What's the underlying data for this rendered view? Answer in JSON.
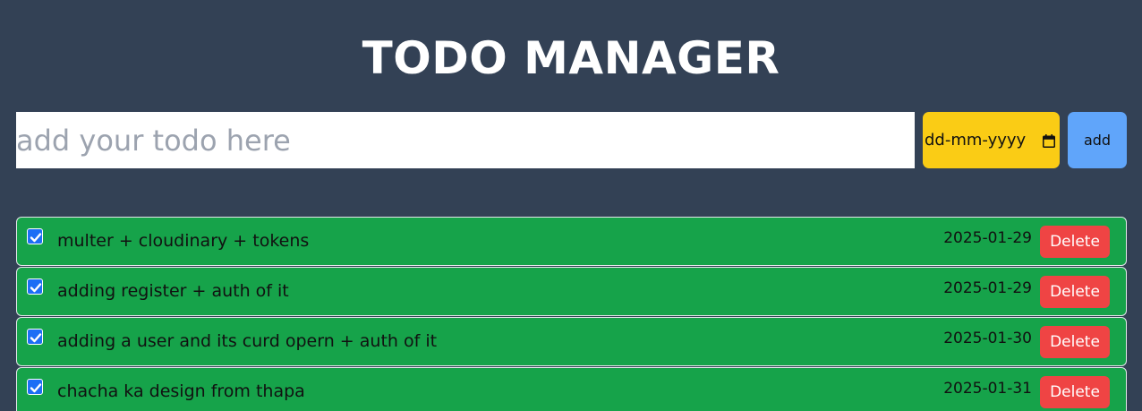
{
  "header": {
    "title": "TODO MANAGER"
  },
  "form": {
    "placeholder": "add your todo here",
    "date_value": "dd-mm-yyyy",
    "add_label": "add"
  },
  "colors": {
    "background": "#334155",
    "item_bg": "#16a34a",
    "delete_bg": "#ef4444",
    "date_bg": "#facc15",
    "add_bg": "#60a5fa"
  },
  "todos": [
    {
      "text": "multer + cloudinary + tokens",
      "date": "2025-01-29",
      "done": true,
      "delete_label": "Delete"
    },
    {
      "text": "adding register + auth of it",
      "date": "2025-01-29",
      "done": true,
      "delete_label": "Delete"
    },
    {
      "text": "adding a user and its curd opern + auth of it",
      "date": "2025-01-30",
      "done": true,
      "delete_label": "Delete"
    },
    {
      "text": "chacha ka design from thapa",
      "date": "2025-01-31",
      "done": true,
      "delete_label": "Delete"
    }
  ]
}
